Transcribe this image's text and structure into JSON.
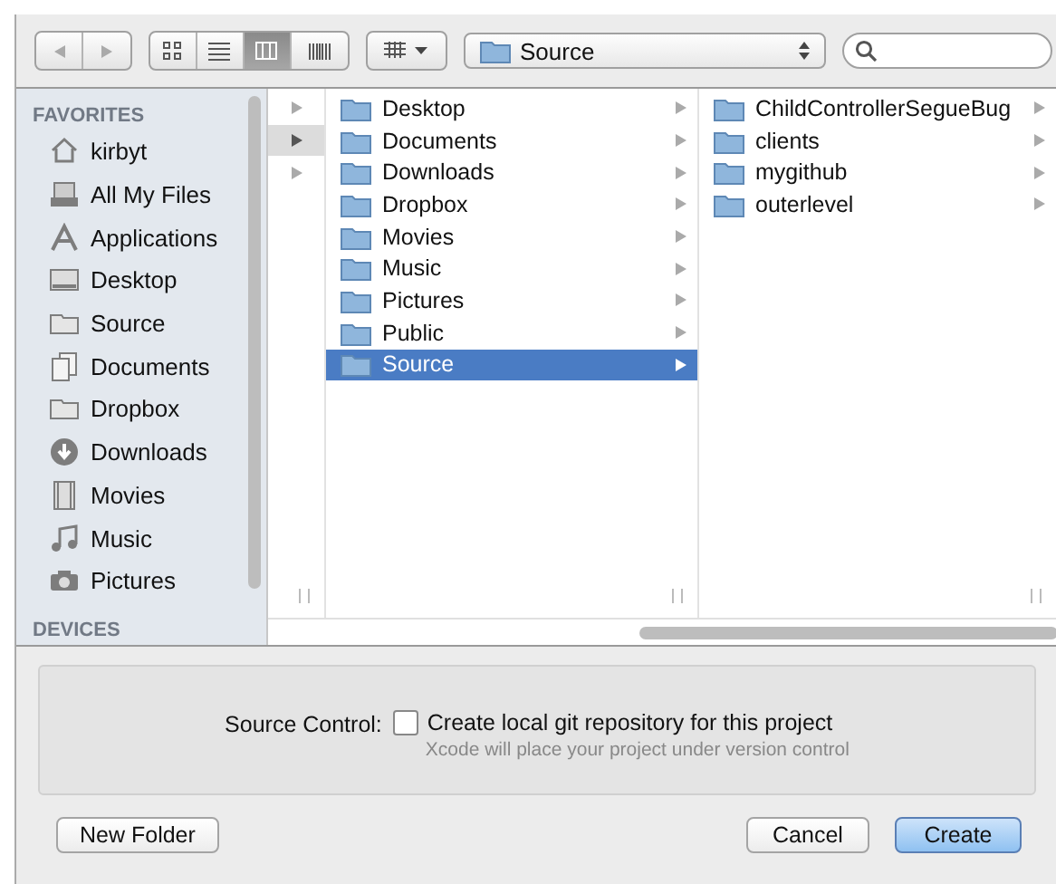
{
  "toolbar": {
    "view_modes": [
      {
        "kind": "icons",
        "selected": false
      },
      {
        "kind": "list",
        "selected": false
      },
      {
        "kind": "columns",
        "selected": true
      },
      {
        "kind": "coverflow",
        "selected": false
      }
    ],
    "path": "Source"
  },
  "sidebar": {
    "sections": [
      {
        "title": "FAVORITES",
        "items": [
          {
            "kind": "home",
            "label": "kirbyt"
          },
          {
            "kind": "files",
            "label": "All My Files"
          },
          {
            "kind": "apps",
            "label": "Applications"
          },
          {
            "kind": "desktop",
            "label": "Desktop"
          },
          {
            "kind": "folder",
            "label": "Source"
          },
          {
            "kind": "documents",
            "label": "Documents"
          },
          {
            "kind": "folder",
            "label": "Dropbox"
          },
          {
            "kind": "downloads",
            "label": "Downloads"
          },
          {
            "kind": "movies",
            "label": "Movies"
          },
          {
            "kind": "music",
            "label": "Music"
          },
          {
            "kind": "camera",
            "label": "Pictures"
          }
        ]
      },
      {
        "title": "DEVICES"
      }
    ]
  },
  "columns": [
    {
      "items": [
        {
          "selected": false
        },
        {
          "selected": true
        },
        {
          "selected": false
        }
      ]
    },
    {
      "items": [
        {
          "label": "Desktop",
          "selected": false
        },
        {
          "label": "Documents",
          "selected": false
        },
        {
          "label": "Downloads",
          "selected": false
        },
        {
          "label": "Dropbox",
          "selected": false
        },
        {
          "label": "Movies",
          "selected": false
        },
        {
          "label": "Music",
          "selected": false
        },
        {
          "label": "Pictures",
          "selected": false
        },
        {
          "label": "Public",
          "selected": false
        },
        {
          "label": "Source",
          "selected": true
        }
      ]
    },
    {
      "items": [
        {
          "label": "ChildControllerSegueBug",
          "selected": false
        },
        {
          "label": "clients",
          "selected": false
        },
        {
          "label": "mygithub",
          "selected": false
        },
        {
          "label": "outerlevel",
          "selected": false
        }
      ]
    }
  ],
  "options": {
    "label": "Source Control:",
    "checkbox": {
      "label": "Create local git repository for this project",
      "checked": false
    },
    "hint": "Xcode will place your project under version control"
  },
  "buttons": {
    "left": [
      {
        "label": "New Folder",
        "default": false
      }
    ],
    "right": [
      {
        "label": "Cancel",
        "default": false
      },
      {
        "label": "Create",
        "default": true
      }
    ]
  }
}
